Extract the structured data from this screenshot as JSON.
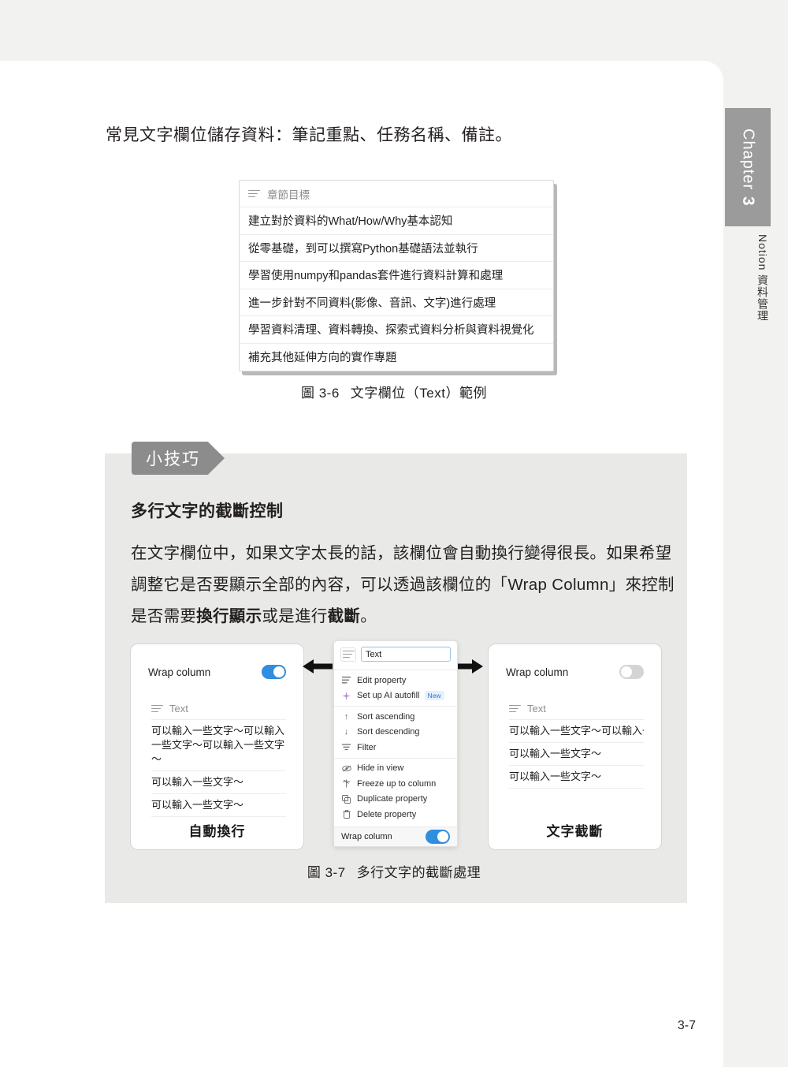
{
  "chapter_tab": {
    "chapter_word": "Chapter",
    "chapter_number": "3",
    "chapter_title": "Notion 資料管理"
  },
  "intro_line": "常見文字欄位儲存資料：筆記重點、任務名稱、備註。",
  "figure_3_6": {
    "table_header_label": "章節目標",
    "header_icon": "text-lines-icon",
    "rows": [
      "建立對於資料的What/How/Why基本認知",
      "從零基礎，到可以撰寫Python基礎語法並執行",
      "學習使用numpy和pandas套件進行資料計算和處理",
      "進一步針對不同資料(影像、音訊、文字)進行處理",
      "學習資料清理、資料轉換、探索式資料分析與資料視覺化",
      "補充其他延伸方向的實作專題"
    ],
    "caption_number": "圖 3-6",
    "caption_text": "文字欄位（Text）範例"
  },
  "tip_box": {
    "tag_label": "小技巧",
    "heading": "多行文字的截斷控制",
    "paragraph_part1": "在文字欄位中，如果文字太長的話，該欄位會自動換行變得很長。如果希望調整它是否要顯示全部的內容，可以透過該欄位的「Wrap Column」來控制是否需要",
    "paragraph_bold1": "換行顯示",
    "paragraph_part2": "或是進行",
    "paragraph_bold2": "截斷",
    "paragraph_part3": "。"
  },
  "figure_3_7": {
    "left_panel": {
      "wrap_column_label": "Wrap column",
      "toggle_state": "on",
      "column_icon": "text-lines-icon",
      "column_label": "Text",
      "rows": [
        "可以輸入一些文字～可以輸入一些文字～可以輸入一些文字～",
        "可以輸入一些文字～",
        "可以輸入一些文字～"
      ],
      "caption": "自動換行"
    },
    "menu": {
      "search_icon": "text-lines-icon",
      "search_value": "Text",
      "items": [
        {
          "icon": "edit-lines-icon",
          "label": "Edit property",
          "badge": ""
        },
        {
          "icon": "sparkle-icon",
          "label": "Set up AI autofill",
          "badge": "New"
        },
        {
          "icon": "arrow-up-icon",
          "label": "Sort ascending",
          "badge": ""
        },
        {
          "icon": "arrow-down-icon",
          "label": "Sort descending",
          "badge": ""
        },
        {
          "icon": "filter-icon",
          "label": "Filter",
          "badge": ""
        },
        {
          "icon": "eye-slash-icon",
          "label": "Hide in view",
          "badge": ""
        },
        {
          "icon": "freeze-icon",
          "label": "Freeze up to column",
          "badge": ""
        },
        {
          "icon": "duplicate-icon",
          "label": "Duplicate property",
          "badge": ""
        },
        {
          "icon": "trash-icon",
          "label": "Delete property",
          "badge": ""
        }
      ],
      "bottom_label": "Wrap column",
      "bottom_toggle_state": "on"
    },
    "right_panel": {
      "wrap_column_label": "Wrap column",
      "toggle_state": "off",
      "column_icon": "text-lines-icon",
      "column_label": "Text",
      "rows": [
        "可以輸入一些文字～可以輸入一些文字～可以輸入一些文字～",
        "可以輸入一些文字～",
        "可以輸入一些文字～"
      ],
      "caption": "文字截斷"
    },
    "caption_number": "圖 3-7",
    "caption_text": "多行文字的截斷處理"
  },
  "page_number": "3-7",
  "colors": {
    "toggle_on": "#2f8ee0",
    "toggle_off": "#d4d4d4",
    "tag_gray": "#8c8c8c",
    "tipbox_bg": "#e9eae7",
    "chapter_block": "#9b9b9b",
    "badge_blue": "#2d7ad1"
  }
}
